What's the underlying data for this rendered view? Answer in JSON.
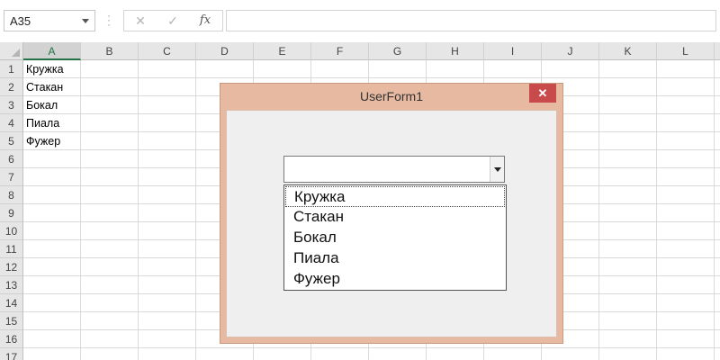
{
  "formula_bar": {
    "name_box": "A35",
    "fx_label": "fx",
    "cancel_glyph": "✕",
    "enter_glyph": "✓",
    "formula_value": ""
  },
  "sheet": {
    "columns": [
      "A",
      "B",
      "C",
      "D",
      "E",
      "F",
      "G",
      "H",
      "I",
      "J",
      "K",
      "L"
    ],
    "selected_column": "A",
    "rows": [
      "1",
      "2",
      "3",
      "4",
      "5",
      "6",
      "7",
      "8",
      "9",
      "10",
      "11",
      "12",
      "13",
      "14",
      "15",
      "16",
      "17"
    ],
    "cells_A": [
      "Кружка",
      "Стакан",
      "Бокал",
      "Пиала",
      "Фужер"
    ]
  },
  "userform": {
    "title": "UserForm1",
    "close_glyph": "✕",
    "title_color": "#e6b9a0",
    "combobox_value": "",
    "list_items": [
      "Кружка",
      "Стакан",
      "Бокал",
      "Пиала",
      "Фужер"
    ]
  },
  "icons": {
    "close": "close-icon",
    "dropdown": "chevron-down-icon"
  }
}
